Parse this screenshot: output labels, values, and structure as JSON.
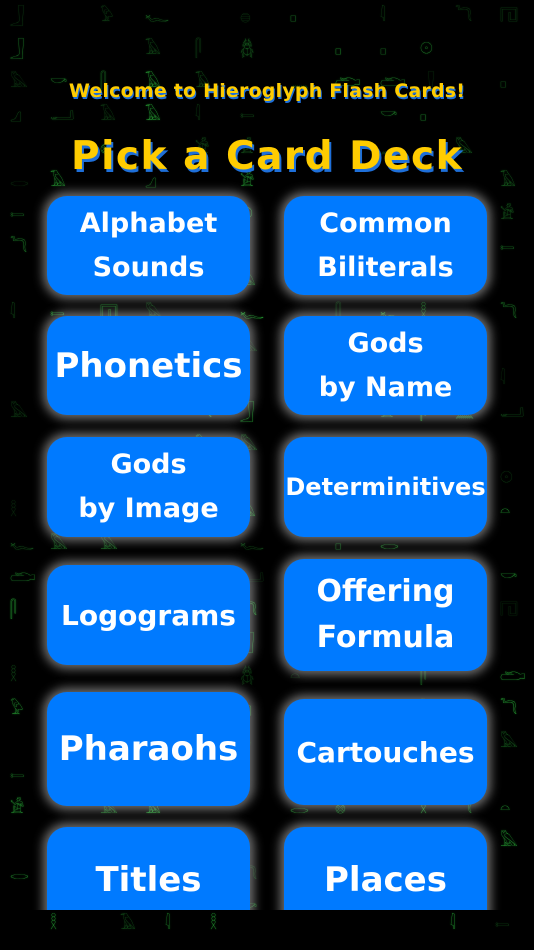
{
  "header": {
    "welcome": "Welcome to Hieroglyph Flash Cards!",
    "title": "Pick a Card Deck"
  },
  "decks": [
    {
      "label": "Alphabet\nSounds"
    },
    {
      "label": "Common\nBiliterals"
    },
    {
      "label": "Phonetics"
    },
    {
      "label": "Gods\nby Name"
    },
    {
      "label": "Gods\nby Image"
    },
    {
      "label": "Determinitives"
    },
    {
      "label": "Logograms"
    },
    {
      "label": "Offering\nFormula"
    },
    {
      "label": "Pharaohs"
    },
    {
      "label": "Cartouches"
    },
    {
      "label": "Titles"
    },
    {
      "label": "Places"
    }
  ],
  "background": {
    "glyph_color": "#2fbf3f",
    "glyphs": [
      "𓂝",
      "𓀀",
      "𓅓",
      "𓈖",
      "𓏏",
      "𓊪",
      "𓎛",
      "𓋴",
      "𓆣",
      "𓂋",
      "𓄿",
      "𓇋",
      "𓅱",
      "𓃀",
      "𓆑",
      "𓐍",
      "𓎡",
      "𓈎",
      "𓇳",
      "𓊖",
      "𓂧",
      "𓍿",
      "𓉔",
      "𓆓"
    ]
  },
  "colors": {
    "button_blue": "#007aff",
    "title_yellow": "#ffcc00",
    "title_shadow": "#1e6fd9"
  }
}
